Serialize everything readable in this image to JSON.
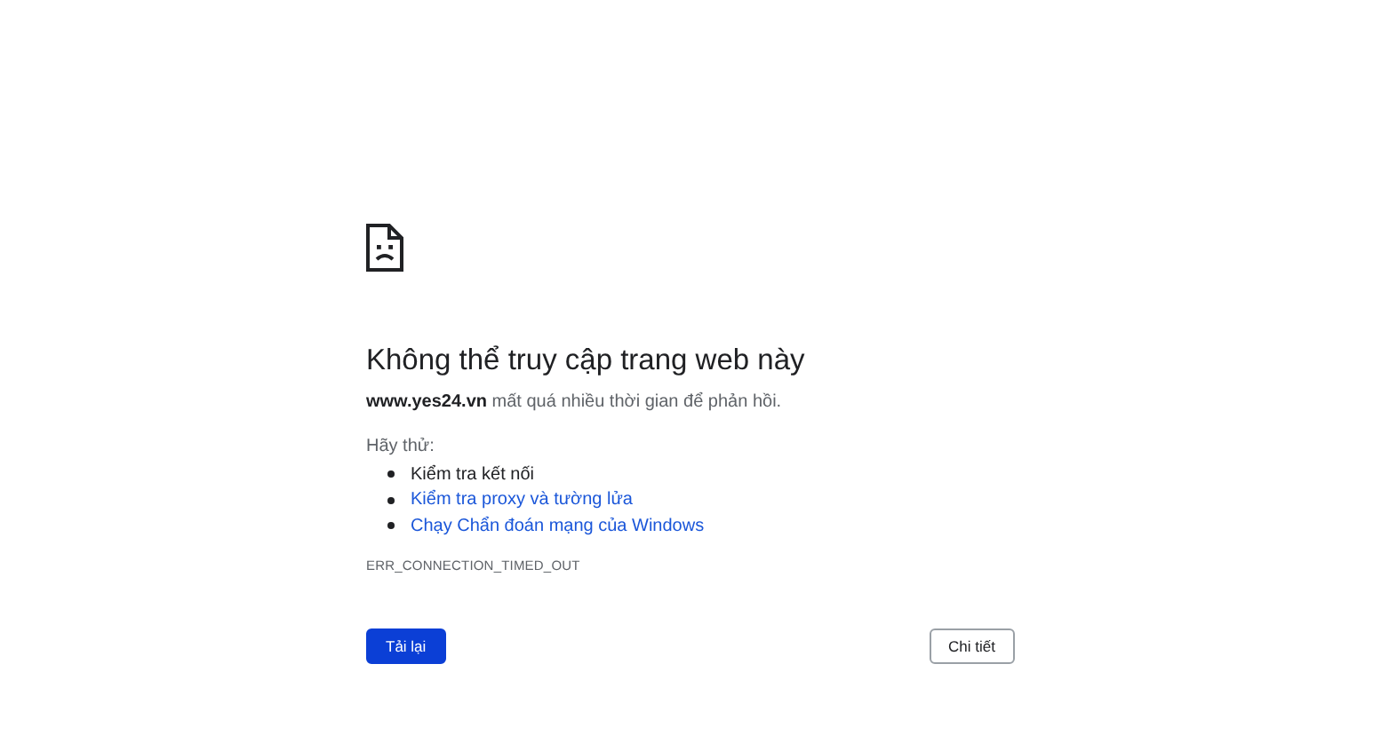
{
  "heading": "Không thể truy cập trang web này",
  "message": "**www.yes24.vn** mất quá nhiều thời gian để phản hồi.",
  "suggestions_label": "Hãy thử:",
  "suggestions": [
    {
      "kind": "text",
      "label": "Kiểm tra kết nối"
    },
    {
      "kind": "link",
      "label": "Kiểm tra proxy và tường lửa"
    },
    {
      "kind": "link",
      "label": "Chạy Chẩn đoán mạng của Windows"
    }
  ],
  "error_code": "ERR_CONNECTION_TIMED_OUT",
  "buttons": [
    {
      "kind": "primary",
      "label": "Tải lại"
    },
    {
      "kind": "secondary",
      "label": "Chi tiết"
    }
  ]
}
